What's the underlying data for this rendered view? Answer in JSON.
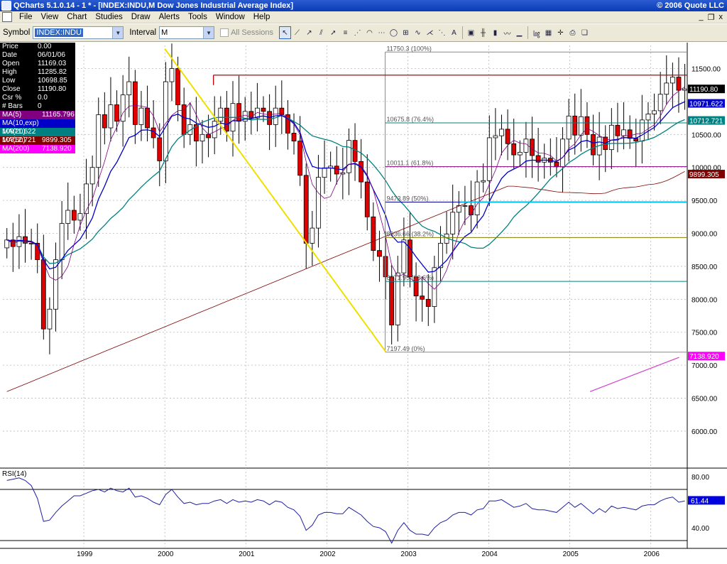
{
  "titlebar": {
    "title": "QCharts 5.1.0.14 - 1 * - [INDEX:INDU,M Dow Jones Industrial Average Index]",
    "copyright": "© 2006 Quote LLC"
  },
  "menu": [
    "File",
    "View",
    "Chart",
    "Studies",
    "Draw",
    "Alerts",
    "Tools",
    "Window",
    "Help"
  ],
  "window_controls": [
    "_",
    "❐",
    "x"
  ],
  "toolbar": {
    "symbol_label": "Symbol",
    "symbol_value": "INDEX:INDU",
    "interval_label": "Interval",
    "interval_value": "M",
    "all_sessions_label": "All Sessions",
    "all_sessions_checked": false,
    "tools": [
      "pointer-icon",
      "line-icon",
      "ray-icon",
      "channel-icon",
      "arrow-icon",
      "fib-icon",
      "fan-icon",
      "arc-icon",
      "retrace-icon",
      "ellipse-icon",
      "gann-icon",
      "cycle-icon",
      "speed-icon",
      "regression-icon",
      "text-icon",
      "chart-prop-icon",
      "bar-icon",
      "candle-icon",
      "line-chart-icon",
      "volume-icon",
      "log-icon",
      "tile-icon",
      "crosshair-icon",
      "print-icon",
      "new-icon"
    ]
  },
  "info_panel": {
    "rows": [
      {
        "k": "Price",
        "v": "0.00"
      },
      {
        "k": "Date",
        "v": "06/01/06"
      },
      {
        "k": "Open",
        "v": "11169.03"
      },
      {
        "k": "High",
        "v": "11285.82"
      },
      {
        "k": "Low",
        "v": "10698.85"
      },
      {
        "k": "Close",
        "v": "11190.80"
      },
      {
        "k": "Csr %",
        "v": "0.0"
      },
      {
        "k": "# Bars",
        "v": "0"
      }
    ],
    "mas": [
      {
        "label": "MA(5)",
        "value": "11165.796",
        "color": "#800080"
      },
      {
        "label": "MA(10,exp)",
        "value": "10971.622",
        "color": "#0000c8"
      },
      {
        "label": "MA(20)",
        "value": "10712.721",
        "color": "#008080"
      },
      {
        "label": "MA(50)",
        "value": "9899.305",
        "color": "#800000"
      },
      {
        "label": "MA(200)",
        "value": "7138.920",
        "color": "#ff00ff"
      }
    ]
  },
  "chart_data": {
    "type": "candlestick",
    "title": "INDEX:INDU,M Dow Jones Industrial Average Index",
    "y_range": [
      5450,
      11850
    ],
    "y_ticks": [
      6000,
      6500,
      7000,
      7500,
      8000,
      8500,
      9000,
      9500,
      10000,
      10500,
      11000,
      11500
    ],
    "y_tick_labels": [
      "6000.00",
      "6500.00",
      "7000.00",
      "7500.00",
      "8000.00",
      "8500.00",
      "9000.00",
      "9500.00",
      "10000.00",
      "10500.00",
      "11000.00",
      "11500.00"
    ],
    "x_ticks": [
      1999,
      2000,
      2001,
      2002,
      2003,
      2004,
      2005,
      2006
    ],
    "x_tick_labels": [
      "1999",
      "2000",
      "2001",
      "2002",
      "2003",
      "2004",
      "2005",
      "2006"
    ],
    "x_range": [
      1998.0,
      2006.45
    ],
    "candles_close": [
      8900,
      8800,
      8950,
      8850,
      8850,
      8600,
      7550,
      7850,
      8600,
      9150,
      9350,
      9200,
      9300,
      9750,
      10000,
      10800,
      10600,
      10950,
      10700,
      11100,
      11300,
      10650,
      10900,
      10600,
      10450,
      10100,
      11300,
      11500,
      10950,
      10500,
      10650,
      10400,
      10500,
      10450,
      10700,
      10900,
      10550,
      10970,
      10700,
      10850,
      10750,
      10900,
      10850,
      10650,
      10900,
      10800,
      10520,
      10400,
      9880,
      8850,
      9080,
      9850,
      9990,
      10020,
      9900,
      9920,
      10410,
      10090,
      9780,
      9250,
      8740,
      8650,
      8340,
      7610,
      8400,
      8900,
      8340,
      8050,
      8000,
      7890,
      8480,
      8850,
      8990,
      9320,
      9420,
      9420,
      9280,
      9780,
      9800,
      10450,
      10480,
      10580,
      10360,
      10190,
      10230,
      10430,
      10180,
      10080,
      10140,
      10080,
      10010,
      10430,
      10780,
      10490,
      10770,
      10500,
      10190,
      10460,
      10270,
      10640,
      10480,
      10570,
      10440,
      10400,
      10720,
      10810,
      10860,
      11110,
      11280,
      11370,
      11170,
      11190
    ],
    "fib_levels": [
      {
        "label": "11750.3 (100%)",
        "value": 11750.3
      },
      {
        "label": "10675.8 (76.4%)",
        "value": 10675.8
      },
      {
        "label": "10011.1 (61.8%)",
        "value": 10011.1
      },
      {
        "label": "9473.89 (50%)",
        "value": 9473.89
      },
      {
        "label": "8936.66 (38.2%)",
        "value": 8936.66
      },
      {
        "label": "8271.95 (23.6%)",
        "value": 8271.95
      },
      {
        "label": "7197.49 (0%)",
        "value": 7197.49
      }
    ],
    "hline_red": 11400,
    "yellow_trendline": [
      [
        2000.0,
        11800
      ],
      [
        2002.73,
        7200
      ]
    ],
    "pink_segment": [
      [
        2005.25,
        6600
      ],
      [
        2006.35,
        7120
      ]
    ],
    "price_tags": [
      {
        "value": 11190.8,
        "label": "11190.80",
        "color": "#000000"
      },
      {
        "value": 10971.622,
        "label": "10971.622",
        "color": "#0000c8"
      },
      {
        "value": 10712.721,
        "label": "10712.721",
        "color": "#008080"
      },
      {
        "value": 9899.305,
        "label": "9899.305",
        "color": "#800000"
      },
      {
        "value": 7138.92,
        "label": "7138.920",
        "color": "#ff00ff"
      }
    ],
    "rsi": {
      "label": "RSI(14)",
      "y_range": [
        25,
        85
      ],
      "y_tick_labels": [
        {
          "value": 80,
          "label": "80.00"
        },
        {
          "value": 40,
          "label": "40.00"
        }
      ],
      "bands": [
        70,
        30
      ],
      "current": {
        "value": 61.44,
        "label": "61.44"
      },
      "values": [
        77,
        78,
        79,
        77,
        73,
        63,
        45,
        46,
        52,
        57,
        61,
        65,
        65,
        67,
        69,
        70,
        68,
        71,
        69,
        68,
        71,
        64,
        65,
        63,
        60,
        58,
        66,
        70,
        64,
        59,
        60,
        58,
        59,
        59,
        61,
        62,
        59,
        62,
        60,
        61,
        60,
        62,
        61,
        58,
        61,
        60,
        56,
        54,
        49,
        38,
        42,
        50,
        52,
        52,
        51,
        51,
        56,
        53,
        50,
        45,
        41,
        40,
        37,
        28,
        38,
        44,
        38,
        35,
        35,
        34,
        40,
        44,
        46,
        50,
        52,
        52,
        50,
        54,
        55,
        61,
        61,
        62,
        59,
        56,
        57,
        59,
        55,
        54,
        54,
        53,
        52,
        56,
        60,
        56,
        59,
        55,
        51,
        55,
        52,
        57,
        55,
        56,
        55,
        54,
        57,
        58,
        58,
        61,
        63,
        64,
        60,
        61
      ]
    }
  }
}
